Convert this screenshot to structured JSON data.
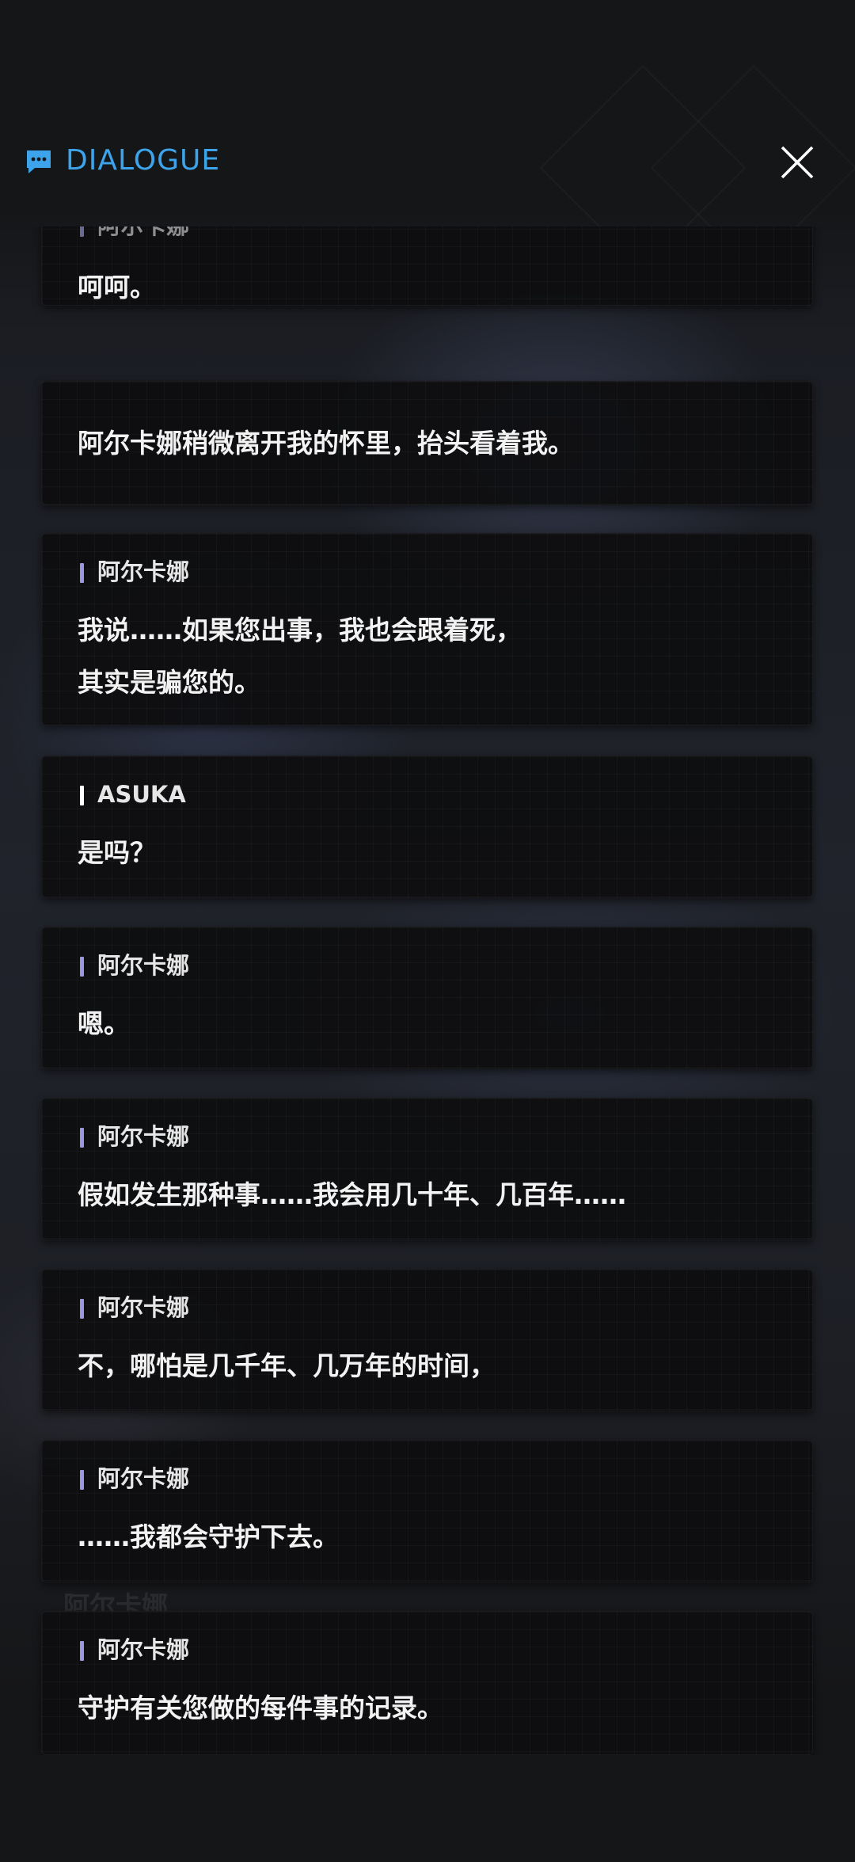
{
  "header": {
    "title": "DIALOGUE",
    "icon": "chat-bubble-icon",
    "close_icon": "close-icon",
    "accent_color": "#3da3ea"
  },
  "entries": [
    {
      "speaker": "阿尔卡娜",
      "text": "呵呵。"
    },
    {
      "speaker": "",
      "text": "阿尔卡娜稍微离开我的怀里，抬头看着我。"
    },
    {
      "speaker": "阿尔卡娜",
      "text": "我说……如果您出事，我也会跟着死，\n其实是骗您的。"
    },
    {
      "speaker": "ASUKA",
      "text": "是吗？"
    },
    {
      "speaker": "阿尔卡娜",
      "text": "嗯。"
    },
    {
      "speaker": "阿尔卡娜",
      "text": "假如发生那种事……我会用几十年、几百年……"
    },
    {
      "speaker": "阿尔卡娜",
      "text": "不，哪怕是几千年、几万年的时间，"
    },
    {
      "speaker": "阿尔卡娜",
      "text": "……我都会守护下去。"
    },
    {
      "speaker": "阿尔卡娜",
      "text": "守护有关您做的每件事的记录。"
    }
  ],
  "speaker_marker_color": "#9a96e0"
}
